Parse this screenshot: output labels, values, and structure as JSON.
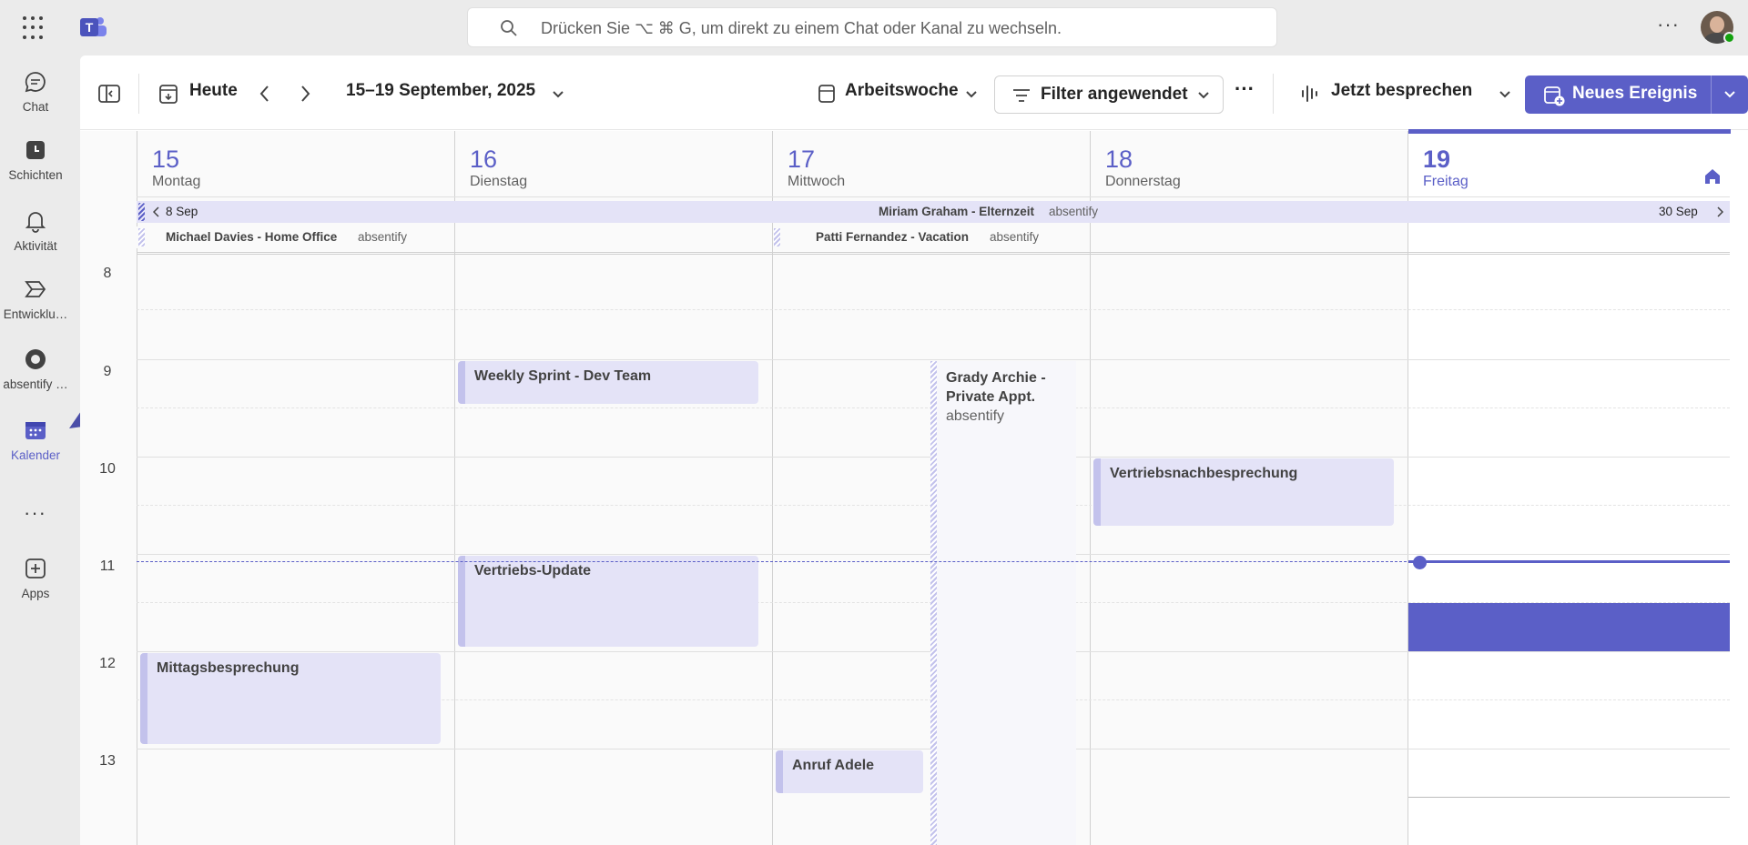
{
  "search": {
    "placeholder": "Drücken Sie ⌥ ⌘ G, um direkt zu einem Chat oder Kanal zu wechseln."
  },
  "rail": [
    {
      "label": "Chat",
      "icon": "chat-icon"
    },
    {
      "label": "Schichten",
      "icon": "shifts-icon"
    },
    {
      "label": "Aktivität",
      "icon": "bell-icon"
    },
    {
      "label": "Entwicklu…",
      "icon": "developer-portal-icon"
    },
    {
      "label": "absentify …",
      "icon": "absentify-icon"
    },
    {
      "label": "Kalender",
      "icon": "calendar-icon"
    },
    {
      "label": "Apps",
      "icon": "add-apps-icon"
    }
  ],
  "toolbar": {
    "today": "Heute",
    "date_range": "15–19 September, 2025",
    "view": "Arbeitswoche",
    "filter": "Filter angewendet",
    "meet_now": "Jetzt besprechen",
    "new_event": "Neues Ereignis"
  },
  "days": [
    {
      "num": "15",
      "name": "Montag"
    },
    {
      "num": "16",
      "name": "Dienstag"
    },
    {
      "num": "17",
      "name": "Mittwoch"
    },
    {
      "num": "18",
      "name": "Donnerstag"
    },
    {
      "num": "19",
      "name": "Freitag"
    }
  ],
  "allday": {
    "start_label": "8 Sep",
    "end_label": "30 Sep",
    "row1_title": "Miriam Graham - Elternzeit",
    "row1_source": "absentify",
    "row2a_title": "Michael Davies - Home Office",
    "row2a_source": "absentify",
    "row2b_title": "Patti Fernandez - Vacation",
    "row2b_source": "absentify"
  },
  "hours": [
    "8",
    "9",
    "10",
    "11",
    "12",
    "13"
  ],
  "events": {
    "weekly_sprint": "Weekly Sprint - Dev Team",
    "grady_title": "Grady Archie - Private Appt.",
    "grady_source": "absentify",
    "vertriebsnach": "Vertriebsnachbesprechung",
    "vertriebs_update": "Vertriebs-Update",
    "mittags": "Mittagsbesprechung",
    "anruf": "Anruf Adele"
  },
  "colors": {
    "accent": "#5b5fc7",
    "event_bg": "#e4e3f7"
  }
}
